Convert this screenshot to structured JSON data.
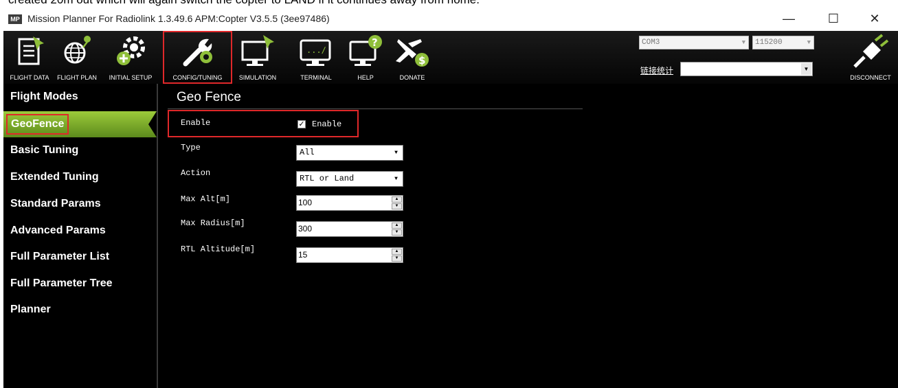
{
  "caption": "created 20m out which will again switch the copter to LAND if it continues away from home.",
  "window": {
    "icon_text": "MP",
    "title": "Mission Planner For Radiolink 1.3.49.6 APM:Copter V3.5.5 (3ee97486)",
    "minimize": "—",
    "maximize": "☐",
    "close": "✕"
  },
  "toolbar": {
    "buttons": [
      {
        "label": "FLIGHT DATA",
        "icon": "flight-data-icon"
      },
      {
        "label": "FLIGHT PLAN",
        "icon": "flight-plan-icon"
      },
      {
        "label": "INITIAL SETUP",
        "icon": "initial-setup-icon"
      },
      {
        "label": "CONFIG/TUNING",
        "icon": "config-tuning-icon"
      },
      {
        "label": "SIMULATION",
        "icon": "simulation-icon"
      },
      {
        "label": "TERMINAL",
        "icon": "terminal-icon"
      },
      {
        "label": "HELP",
        "icon": "help-icon"
      },
      {
        "label": "DONATE",
        "icon": "donate-icon"
      }
    ],
    "active": "CONFIG/TUNING",
    "port": "COM3",
    "baud": "115200",
    "stats_label": "链接统计",
    "disconnect": "DISCONNECT"
  },
  "sidebar": {
    "items": [
      "Flight Modes",
      "GeoFence",
      "Basic Tuning",
      "Extended Tuning",
      "Standard Params",
      "Advanced Params",
      "Full Parameter List",
      "Full Parameter Tree",
      "Planner"
    ],
    "active": "GeoFence"
  },
  "geofence": {
    "title": "Geo Fence",
    "enable_label": "Enable",
    "enable_checkbox_label": "Enable",
    "enable_checked": true,
    "type_label": "Type",
    "type_value": "All",
    "action_label": "Action",
    "action_value": "RTL or Land",
    "max_alt_label": "Max Alt[m]",
    "max_alt_value": "100",
    "max_radius_label": "Max Radius[m]",
    "max_radius_value": "300",
    "rtl_alt_label": "RTL Altitude[m]",
    "rtl_alt_value": "15"
  },
  "colors": {
    "accent_green": "#7ab52a",
    "highlight_red": "#e0282a",
    "background": "#000000"
  }
}
